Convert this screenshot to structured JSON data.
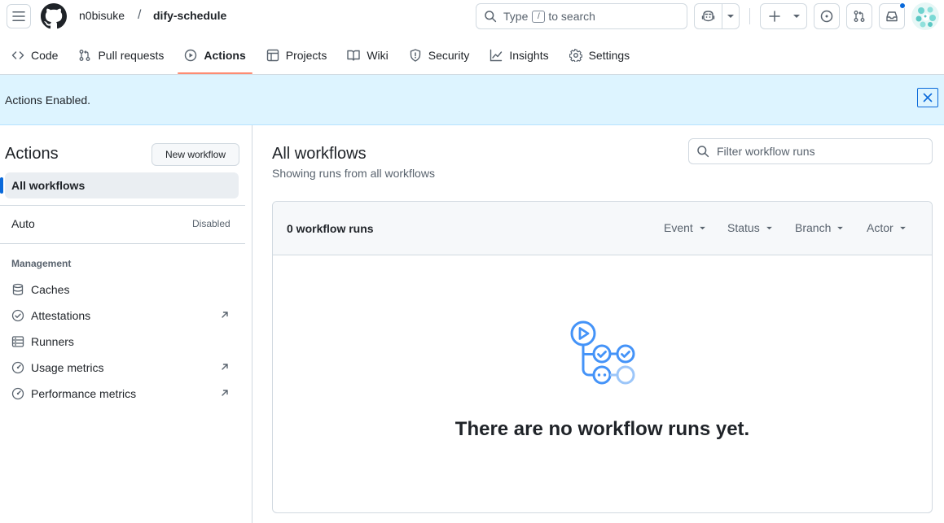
{
  "header": {
    "owner": "n0bisuke",
    "separator": "/",
    "repo": "dify-schedule",
    "search": {
      "prefix": "Type",
      "key": "/",
      "suffix": "to search"
    }
  },
  "tabs": [
    {
      "label": "Code",
      "icon": "code-icon"
    },
    {
      "label": "Pull requests",
      "icon": "git-pull-request-icon"
    },
    {
      "label": "Actions",
      "icon": "play-icon",
      "active": true
    },
    {
      "label": "Projects",
      "icon": "table-icon"
    },
    {
      "label": "Wiki",
      "icon": "book-icon"
    },
    {
      "label": "Security",
      "icon": "shield-icon"
    },
    {
      "label": "Insights",
      "icon": "graph-icon"
    },
    {
      "label": "Settings",
      "icon": "gear-icon"
    }
  ],
  "flash": {
    "message": "Actions Enabled."
  },
  "sidebar": {
    "title": "Actions",
    "new_workflow_label": "New workflow",
    "active_item": "All workflows",
    "workflows": [
      {
        "name": "Auto",
        "status": "Disabled"
      }
    ],
    "management_heading": "Management",
    "management_items": [
      {
        "label": "Caches",
        "icon": "database-icon",
        "external": false
      },
      {
        "label": "Attestations",
        "icon": "check-circle-icon",
        "external": true
      },
      {
        "label": "Runners",
        "icon": "server-icon",
        "external": false
      },
      {
        "label": "Usage metrics",
        "icon": "meter-icon",
        "external": true
      },
      {
        "label": "Performance metrics",
        "icon": "meter-icon",
        "external": true
      }
    ]
  },
  "main": {
    "title": "All workflows",
    "subtitle": "Showing runs from all workflows",
    "filter_placeholder": "Filter workflow runs",
    "runs_count_label": "0 workflow runs",
    "filters": [
      "Event",
      "Status",
      "Branch",
      "Actor"
    ],
    "empty_message": "There are no workflow runs yet."
  },
  "colors": {
    "accent": "#0969da",
    "flash_bg": "#ddf4ff",
    "active_tab_underline": "#fd8c73",
    "workflow_icon": "#4493f8"
  }
}
